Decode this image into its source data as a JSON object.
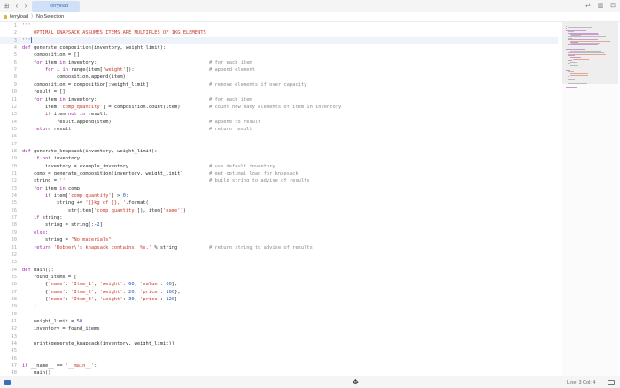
{
  "tab": {
    "label": "lorryload"
  },
  "breadcrumb": {
    "file": "lorryload",
    "separator": "〉",
    "symbol": "No Selection"
  },
  "status": {
    "line_col": "Line: 3  Col: 4"
  },
  "colors": {
    "accent": "#3a6db5",
    "keyword": "#9c1fa6",
    "string": "#c93a2a",
    "number": "#1b55c0",
    "comment": "#8a8a8a"
  },
  "code_lines": [
    "'''",
    "    OPTIMAL KNAPSACK ASSUMES ITEMS ARE MULTIPLES OF 1KG ELEMENTS",
    "'''",
    "def generate_composition(inventory, weight_limit):",
    "    composition = []",
    "    for item in inventory:                                       # for each item",
    "        for i in range(item['weight']):                          # append element",
    "            composition.append(item)",
    "    composition = composition[:weight_limit]                     # remove elements if over capacity",
    "    result = []",
    "    for item in inventory:                                       # for each item",
    "        item['comp_quantity'] = composition.count(item)          # count how many elements of item in inventory",
    "        if item not in result:",
    "            result.append(item)                                  # append to result",
    "    return result                                                # return result",
    "",
    "",
    "def generate_knapsack(inventory, weight_limit):",
    "    if not inventory:",
    "        inventory = example_inventory                            # use default inventory",
    "    comp = generate_composition(inventory, weight_limit)         # get optimal load for knapsack",
    "    string = ''                                                  # build string to advise of results",
    "    for item in comp:",
    "        if item['comp_quantity'] > 0:",
    "            string += '{}kg of {}, '.format(",
    "                str(item['comp_quantity']), item['name'])",
    "    if string:",
    "        string = string[:-2]",
    "    else:",
    "        string = \"No materials\"",
    "    return 'Robber\\'s knapsack contains: %s.' % string           # return string to advise of results",
    "",
    "",
    "def main():",
    "    found_items = [",
    "        {'name': 'Item_1', 'weight': 60, 'value': 60},",
    "        {'name': 'Item_2', 'weight': 20, 'price': 100},",
    "        {'name': 'Item_3', 'weight': 30, 'price': 120}",
    "    ]",
    "",
    "    weight_limit = 50",
    "    inventory = found_items",
    "",
    "    print(generate_knapsack(inventory, weight_limit))",
    "",
    "",
    "if __name__ == '__main__':",
    "    main()"
  ]
}
